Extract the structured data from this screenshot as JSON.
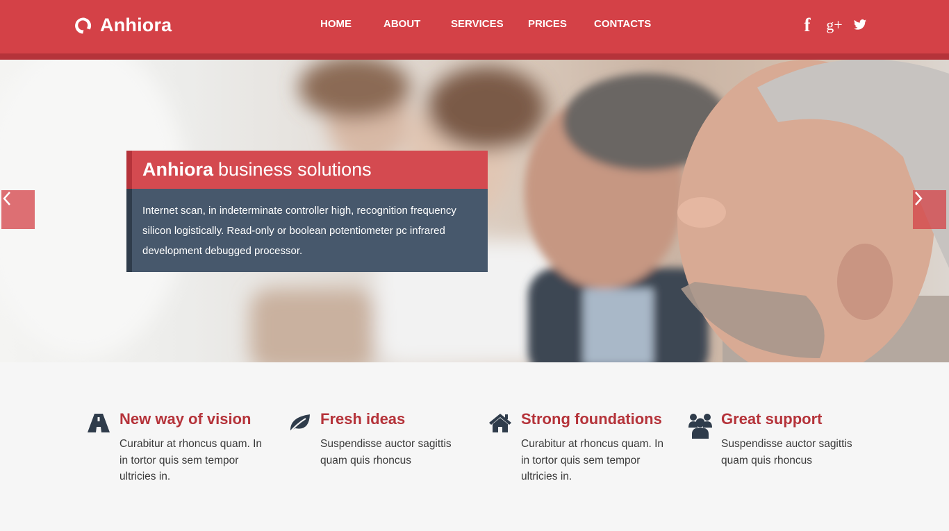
{
  "brand": {
    "name": "Anhiora",
    "accent": "#d44147",
    "accent_dark": "#b5333a",
    "panel": "#47586c"
  },
  "nav": {
    "items": [
      {
        "label": "HOME"
      },
      {
        "label": "ABOUT"
      },
      {
        "label": "SERVICES"
      },
      {
        "label": "PRICES"
      },
      {
        "label": "CONTACTS"
      }
    ]
  },
  "social": {
    "icons": [
      "facebook-icon",
      "google-plus-icon",
      "twitter-icon"
    ],
    "facebook": "f",
    "google_plus": "g+"
  },
  "hero": {
    "title_bold": "Anhiora",
    "title_rest": "business solutions",
    "body": "Internet scan, in indeterminate controller high, recognition frequency silicon logistically. Read-only or boolean potentiometer pc infrared development debugged processor.",
    "prev_icon": "chevron-left-icon",
    "next_icon": "chevron-right-icon"
  },
  "features": [
    {
      "icon": "road-icon",
      "title": "New way of vision",
      "text": "Curabitur at rhoncus quam. In in tortor quis sem tempor ultricies in."
    },
    {
      "icon": "leaf-icon",
      "title": "Fresh ideas",
      "text": "Suspendisse auctor sagittis quam quis rhoncus"
    },
    {
      "icon": "home-icon",
      "title": "Strong foundations",
      "text": "Curabitur at rhoncus quam. In in tortor quis sem tempor ultricies in."
    },
    {
      "icon": "users-icon",
      "title": "Great support",
      "text": "Suspendisse auctor sagittis quam quis rhoncus"
    }
  ]
}
